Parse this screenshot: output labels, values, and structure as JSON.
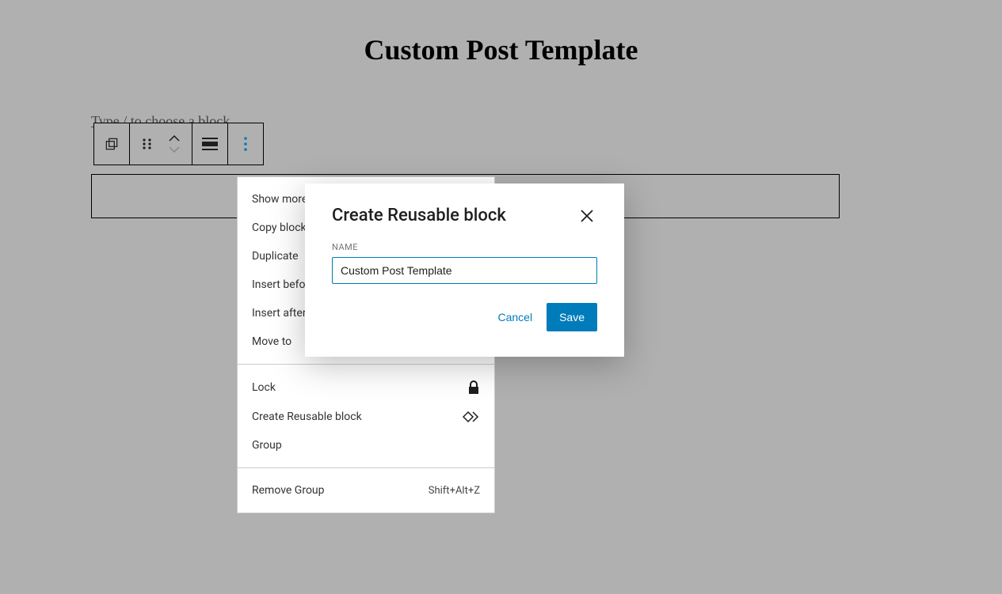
{
  "page_title": "Custom Post Template",
  "placeholder_hint": "Type / to choose a block",
  "menu": {
    "section1": {
      "show_more": "Show more settings",
      "copy": "Copy block",
      "duplicate": "Duplicate",
      "insert_before": "Insert before",
      "insert_after": "Insert after",
      "move_to": "Move to"
    },
    "section2": {
      "lock": "Lock",
      "create_reusable": "Create Reusable block",
      "group": "Group"
    },
    "section3": {
      "remove_group": "Remove Group",
      "remove_shortcut": "Shift+Alt+Z"
    }
  },
  "dialog": {
    "title": "Create Reusable block",
    "name_label": "NAME",
    "name_value": "Custom Post Template",
    "cancel": "Cancel",
    "save": "Save"
  }
}
